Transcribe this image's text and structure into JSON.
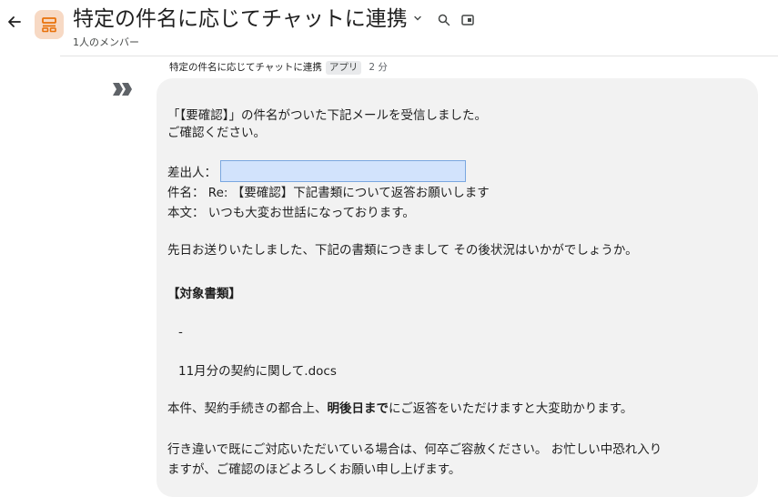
{
  "header": {
    "title": "特定の件名に応じてチャットに連携",
    "member_count": "1人のメンバー",
    "icons": [
      "back-arrow-icon",
      "space-icon",
      "chevron-down-icon",
      "search-icon",
      "thread-panel-icon"
    ],
    "accent_color": "#e8710a"
  },
  "message": {
    "sender": "特定の件名に応じてチャットに連携",
    "badge": "アプリ",
    "time": "2 分",
    "lines": {
      "l1": "「【要確認】」の件名がついた下記メールを受信しました。",
      "l2": "ご確認ください。",
      "from_label": "差出人：",
      "subject": "件名： Re: 【要確認】下記書類について返答お願いします",
      "body": "本文： いつも大変お世話になっております。",
      "p1": "先日お送りいたしました、下記の書類につきまして その後状況はいかがでしょうか。",
      "target_heading": "【対象書類】",
      "dash": "-",
      "doc": "11月分の契約に関して.docs",
      "p2_a": "本件、契約手続きの都合上、",
      "p2_bold": "明後日まで",
      "p2_b": "にご返答をいただけますと大変助かります。",
      "p3_a": "行き違いで既にご対応いただいている場合は、何卒ご容赦ください。 お忙しい中恐れ入り",
      "p3_b": "ますが、ご確認のほどよろしくお願い申し上げます。"
    }
  }
}
